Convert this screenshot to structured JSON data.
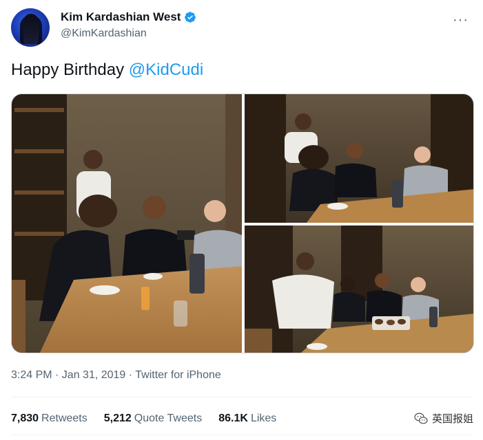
{
  "author": {
    "display_name": "Kim Kardashian West",
    "handle": "@KimKardashian",
    "verified": true
  },
  "tweet": {
    "text": "Happy Birthday ",
    "mention": "@KidCudi"
  },
  "meta": {
    "time": "3:24 PM",
    "date": "Jan 31, 2019",
    "source": "Twitter for iPhone",
    "full": "3:24 PM · Jan 31, 2019 · Twitter for iPhone"
  },
  "stats": [
    {
      "value": "7,830",
      "label": "Retweets"
    },
    {
      "value": "5,212",
      "label": "Quote Tweets"
    },
    {
      "value": "86.1K",
      "label": "Likes"
    }
  ],
  "watermark": {
    "text": "英国报姐"
  },
  "colors": {
    "link": "#1d9bf0",
    "secondary_text": "#536471",
    "verified": "#1d9bf0"
  },
  "icons": [
    "verified-badge-icon",
    "more-options-icon",
    "wechat-icon"
  ]
}
